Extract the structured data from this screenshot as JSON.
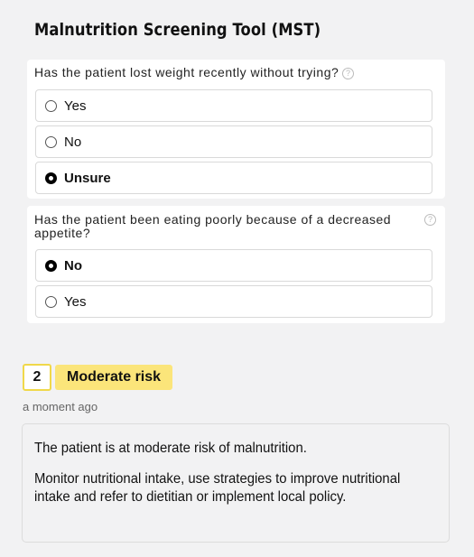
{
  "tool": {
    "title": "Malnutrition Screening Tool (MST)"
  },
  "questions": [
    {
      "text": "Has the patient lost weight recently without trying?",
      "help": "?",
      "options": [
        {
          "label": "Yes",
          "selected": false
        },
        {
          "label": "No",
          "selected": false
        },
        {
          "label": "Unsure",
          "selected": true
        }
      ]
    },
    {
      "text": "Has the patient been eating poorly because of a decreased appetite?",
      "help": "?",
      "options": [
        {
          "label": "No",
          "selected": true
        },
        {
          "label": "Yes",
          "selected": false
        }
      ]
    }
  ],
  "result": {
    "score": "2",
    "risk_label": "Moderate risk",
    "timestamp": "a moment ago",
    "summary": "The patient is at moderate risk of malnutrition.",
    "recommendation": "Monitor nutritional intake, use strategies to improve nutritional intake and refer to dietitian or implement local policy."
  },
  "colors": {
    "background": "#f2f2f3",
    "risk_badge": "#fbe57a",
    "score_border": "#f0d84a"
  }
}
